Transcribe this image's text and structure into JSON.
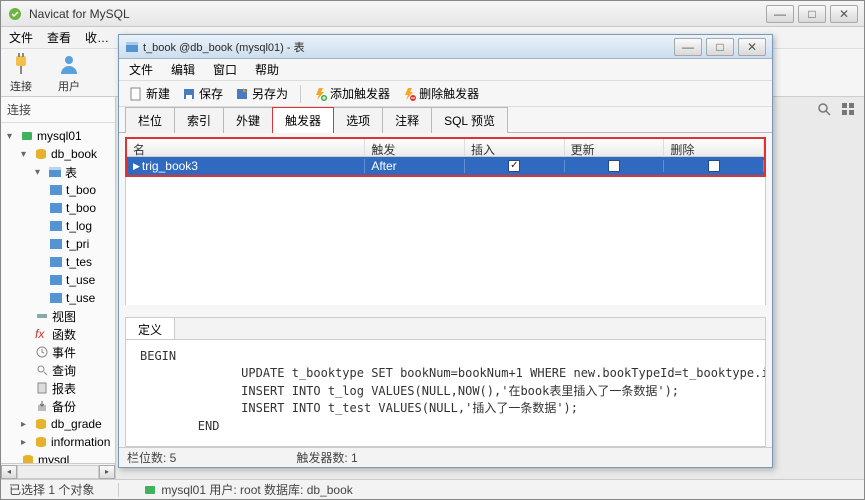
{
  "app": {
    "title": "Navicat for MySQL"
  },
  "main_menu": [
    "文件",
    "查看",
    "收…"
  ],
  "main_toolbar": {
    "connect": "连接",
    "user": "用户"
  },
  "sidebar": {
    "header": "连接",
    "nodes": {
      "conn": "mysql01",
      "db": "db_book",
      "tables_label": "表",
      "tables": [
        "t_boo",
        "t_boo",
        "t_log",
        "t_pri",
        "t_tes",
        "t_use",
        "t_use"
      ],
      "views": "视图",
      "funcs": "函数",
      "events": "事件",
      "queries": "查询",
      "reports": "报表",
      "backups": "备份",
      "db2": "db_grade",
      "db3": "information",
      "db4": "mysql"
    }
  },
  "child": {
    "title": "t_book @db_book (mysql01) - 表",
    "menu": [
      "文件",
      "编辑",
      "窗口",
      "帮助"
    ],
    "toolbar": {
      "new": "新建",
      "save": "保存",
      "saveas": "另存为",
      "add_trig": "添加触发器",
      "del_trig": "删除触发器"
    },
    "tabs": [
      "栏位",
      "索引",
      "外键",
      "触发器",
      "选项",
      "注释",
      "SQL 预览"
    ],
    "active_tab": 3,
    "table": {
      "headers": {
        "name": "名",
        "trigger": "触发",
        "insert": "插入",
        "update": "更新",
        "delete": "删除"
      },
      "row": {
        "name": "trig_book3",
        "trigger": "After",
        "insert": true,
        "update": false,
        "delete": false
      }
    },
    "def": {
      "tab": "定义",
      "body": "BEGIN\n              UPDATE t_booktype SET bookNum=bookNum+1 WHERE new.bookTypeId=t_booktype.id;\n              INSERT INTO t_log VALUES(NULL,NOW(),'在book表里插入了一条数据');\n              INSERT INTO t_test VALUES(NULL,'插入了一条数据');\n        END"
    },
    "status": {
      "cols": "栏位数: 5",
      "trigs": "触发器数: 1"
    }
  },
  "status": {
    "sel": "已选择 1 个对象",
    "conn_info": "mysql01  用户: root  数据库: db_book"
  }
}
